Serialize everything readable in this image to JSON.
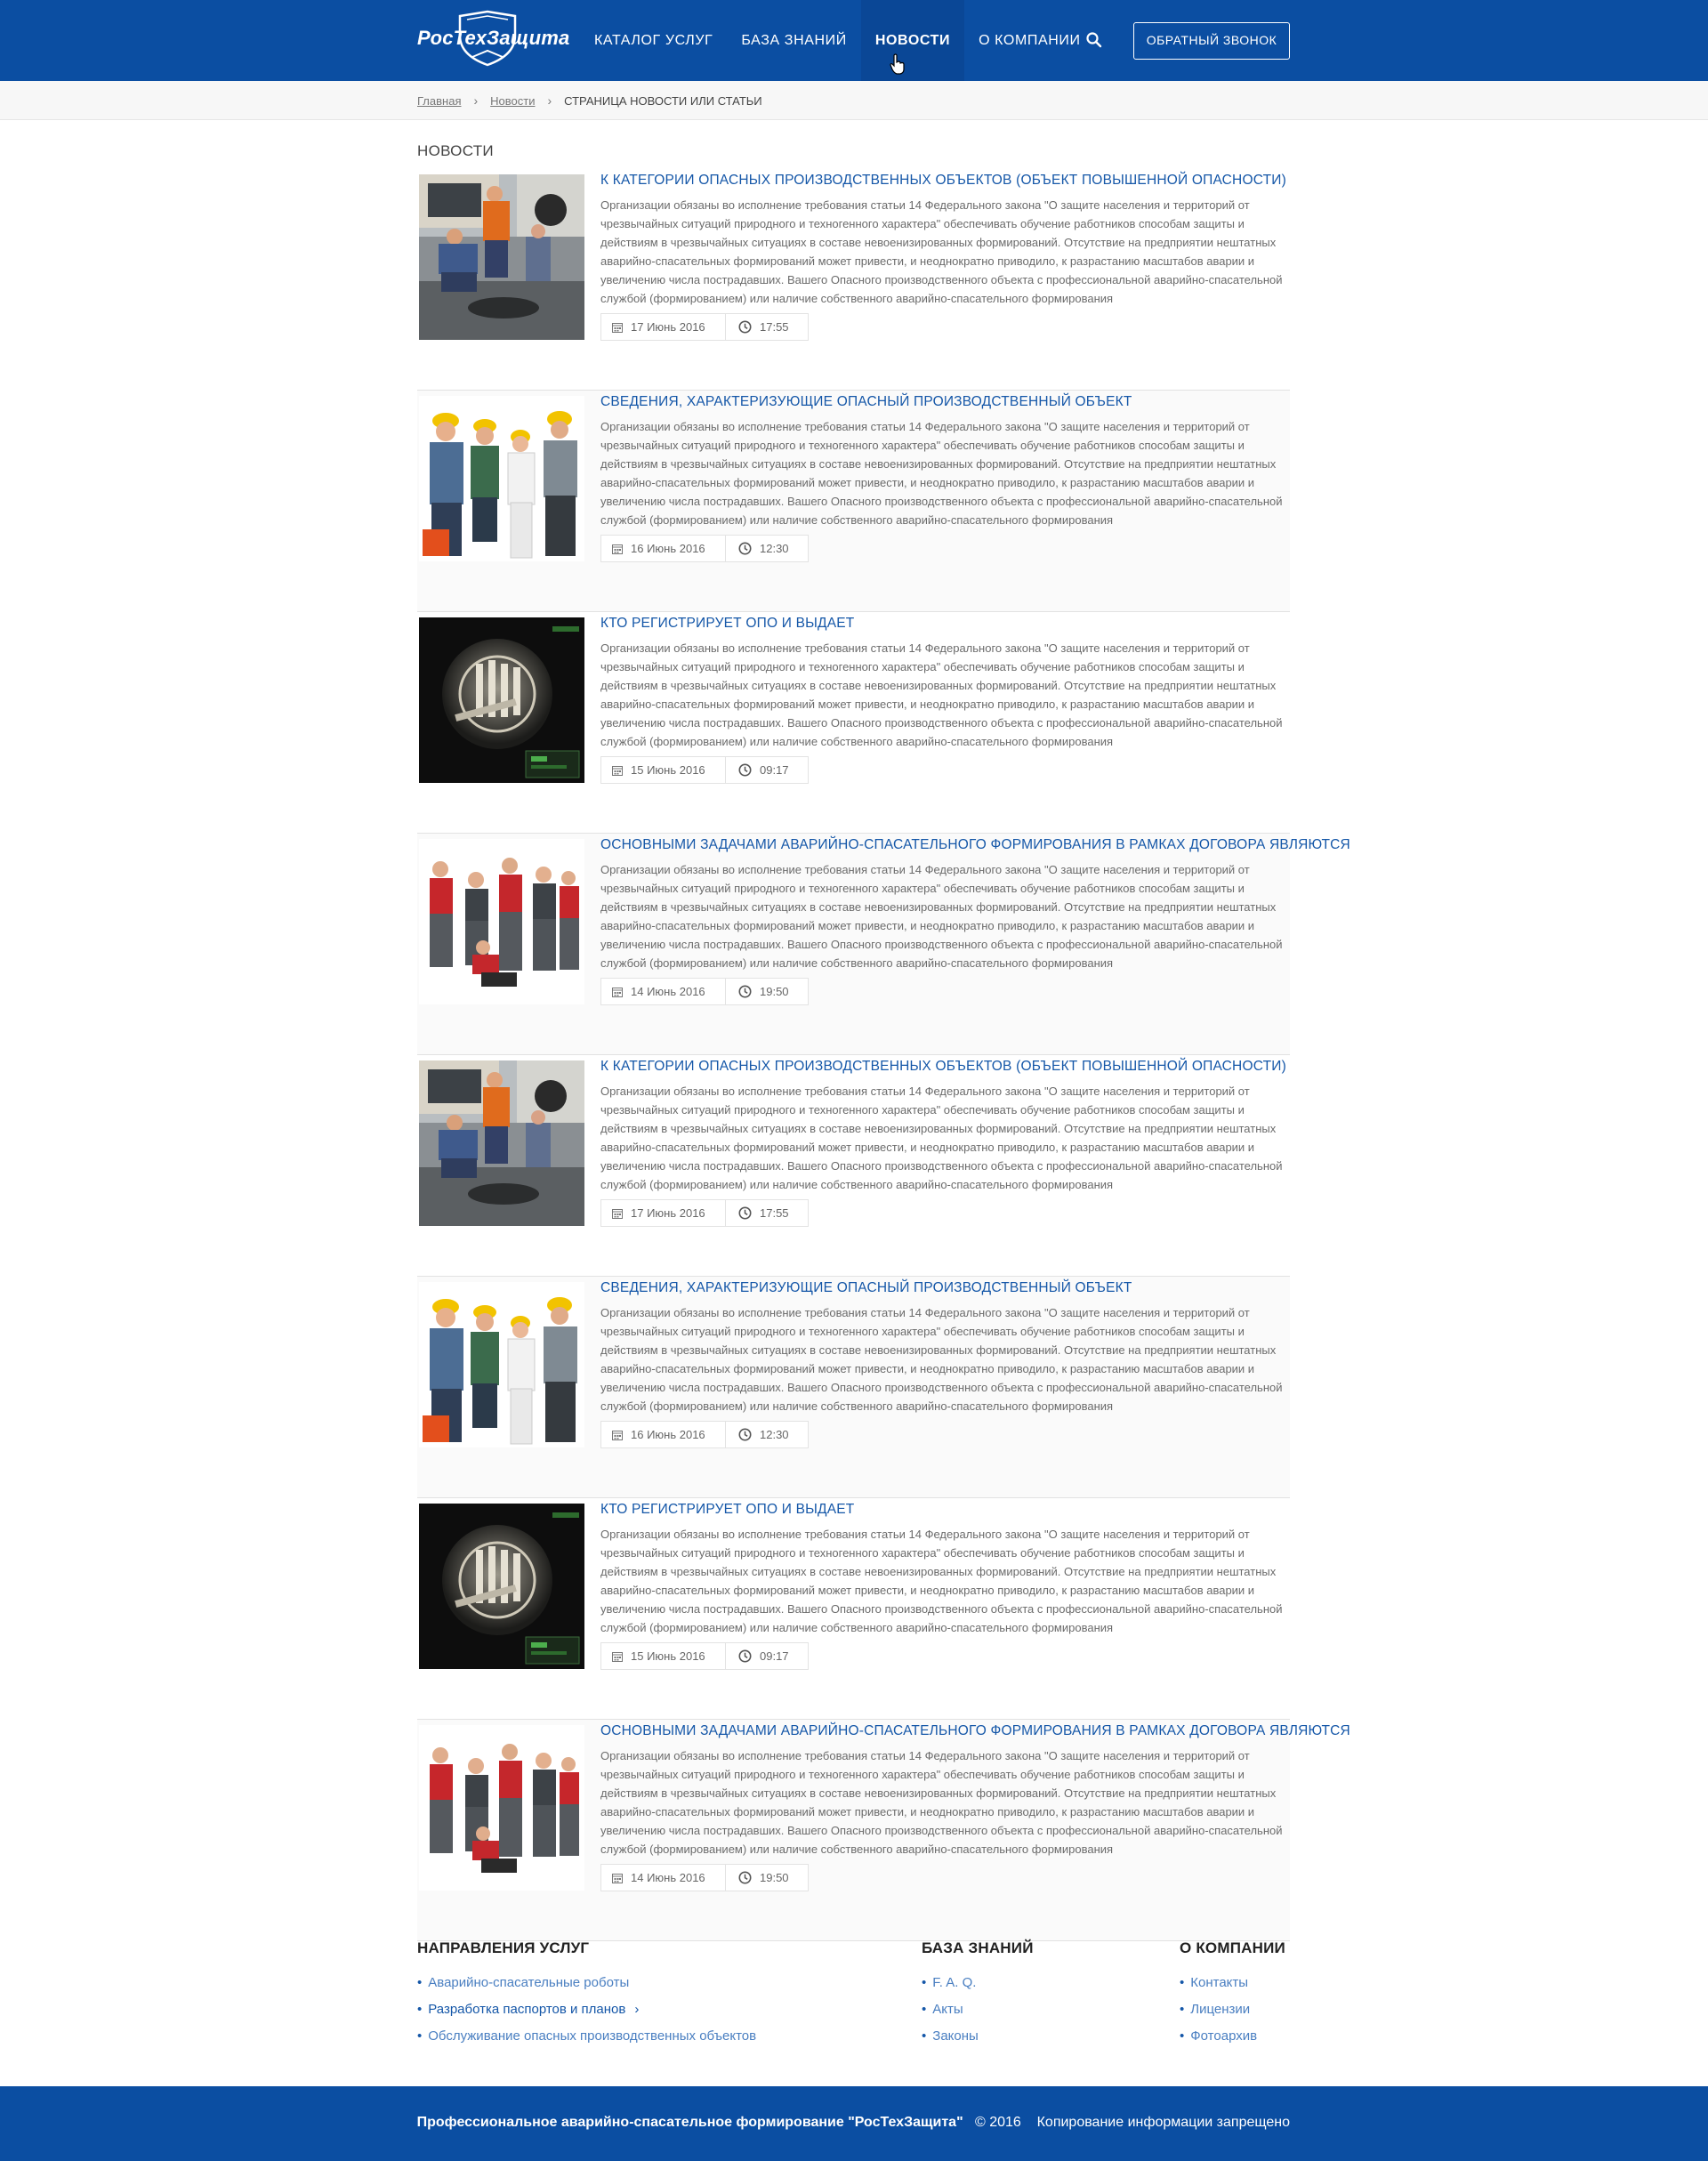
{
  "header": {
    "logo_text": "РосТехЗащита",
    "nav": [
      "Каталог услуг",
      "База знаний",
      "Новости",
      "О компании"
    ],
    "active_nav": "Новости",
    "callback_label": "Обратный звонок"
  },
  "breadcrumb": {
    "home": "Главная",
    "news": "Новости",
    "current": "Страница новости или статьи"
  },
  "page_title": "Новости",
  "articles": [
    {
      "title": "К категории опасных производственных объектов (объект повышенной опасности)",
      "text": "Организации обязаны во исполнение требования статьи 14 Федерального закона \"О защите населения и территорий от чрезвычайных ситуаций природного и техногенного характера\" обеспечивать обучение работников способам защиты и действиям в чрезвычайных ситуациях в составе невоенизированных формирований. Отсутствие на предприятии нештатных аварийно-спасательных формирований может привести, и неоднократно приводило, к разрастанию масштабов аварии и увеличению числа пострадавших.  Вашего Опасного производственного объекта с профессиональной аварийно-спасательной службой (формированием) или наличие собственного аварийно-спасательного формирования",
      "date": "17 Июнь 2016",
      "time": "17:55",
      "image": "workers-manhole"
    },
    {
      "title": "Сведения, характеризующие опасный производственный объект",
      "text": "Организации обязаны во исполнение требования статьи 14 Федерального закона \"О защите населения и территорий от чрезвычайных ситуаций природного и техногенного характера\" обеспечивать обучение работников способам защиты и действиям в чрезвычайных ситуациях в составе невоенизированных формирований. Отсутствие на предприятии нештатных аварийно-спасательных формирований может привести, и неоднократно приводило, к разрастанию масштабов аварии и увеличению числа пострадавших.  Вашего Опасного производственного объекта с профессиональной аварийно-спасательной службой (формированием) или наличие собственного аварийно-спасательного формирования",
      "date": "16 Июнь 2016",
      "time": "12:30",
      "image": "workers-helmets"
    },
    {
      "title": "Кто регистрирует ОПО и выдает",
      "text": "Организации обязаны во исполнение требования статьи 14 Федерального закона \"О защите населения и территорий от чрезвычайных ситуаций природного и техногенного характера\" обеспечивать обучение работников способам защиты и действиям в чрезвычайных ситуациях в составе невоенизированных формирований. Отсутствие на предприятии нештатных аварийно-спасательных формирований может привести, и неоднократно приводило, к разрастанию масштабов аварии и увеличению числа пострадавших.  Вашего Опасного производственного объекта с профессиональной аварийно-спасательной службой (формированием) или наличие собственного аварийно-спасательного формирования",
      "date": "15 Июнь 2016",
      "time": "09:17",
      "image": "vault-door"
    },
    {
      "title": "Основными задачами аварийно-спасательного формирования в рамках договора являются",
      "text": "Организации обязаны во исполнение требования статьи 14 Федерального закона \"О защите населения и территорий от чрезвычайных ситуаций природного и техногенного характера\" обеспечивать обучение работников способам защиты и действиям в чрезвычайных ситуациях в составе невоенизированных формирований. Отсутствие на предприятии нештатных аварийно-спасательных формирований может привести, и неоднократно приводило, к разрастанию масштабов аварии и увеличению числа пострадавших.  Вашего Опасного производственного объекта с профессиональной аварийно-спасательной службой (формированием) или наличие собственного аварийно-спасательного формирования",
      "date": "14 Июнь 2016",
      "time": "19:50",
      "image": "workers-team"
    },
    {
      "title": "К категории опасных производственных объектов (объект повышенной опасности)",
      "text": "Организации обязаны во исполнение требования статьи 14 Федерального закона \"О защите населения и территорий от чрезвычайных ситуаций природного и техногенного характера\" обеспечивать обучение работников способам защиты и действиям в чрезвычайных ситуациях в составе невоенизированных формирований. Отсутствие на предприятии нештатных аварийно-спасательных формирований может привести, и неоднократно приводило, к разрастанию масштабов аварии и увеличению числа пострадавших.  Вашего Опасного производственного объекта с профессиональной аварийно-спасательной службой (формированием) или наличие собственного аварийно-спасательного формирования",
      "date": "17 Июнь 2016",
      "time": "17:55",
      "image": "workers-manhole"
    },
    {
      "title": "Сведения, характеризующие опасный производственный объект",
      "text": "Организации обязаны во исполнение требования статьи 14 Федерального закона \"О защите населения и территорий от чрезвычайных ситуаций природного и техногенного характера\" обеспечивать обучение работников способам защиты и действиям в чрезвычайных ситуациях в составе невоенизированных формирований. Отсутствие на предприятии нештатных аварийно-спасательных формирований может привести, и неоднократно приводило, к разрастанию масштабов аварии и увеличению числа пострадавших.  Вашего Опасного производственного объекта с профессиональной аварийно-спасательной службой (формированием) или наличие собственного аварийно-спасательного формирования",
      "date": "16 Июнь 2016",
      "time": "12:30",
      "image": "workers-helmets"
    },
    {
      "title": "Кто регистрирует ОПО и выдает",
      "text": "Организации обязаны во исполнение требования статьи 14 Федерального закона \"О защите населения и территорий от чрезвычайных ситуаций природного и техногенного характера\" обеспечивать обучение работников способам защиты и действиям в чрезвычайных ситуациях в составе невоенизированных формирований. Отсутствие на предприятии нештатных аварийно-спасательных формирований может привести, и неоднократно приводило, к разрастанию масштабов аварии и увеличению числа пострадавших.  Вашего Опасного производственного объекта с профессиональной аварийно-спасательной службой (формированием) или наличие собственного аварийно-спасательного формирования",
      "date": "15 Июнь 2016",
      "time": "09:17",
      "image": "vault-door"
    },
    {
      "title": "Основными задачами аварийно-спасательного формирования в рамках договора являются",
      "text": "Организации обязаны во исполнение требования статьи 14 Федерального закона \"О защите населения и территорий от чрезвычайных ситуаций природного и техногенного характера\" обеспечивать обучение работников способам защиты и действиям в чрезвычайных ситуациях в составе невоенизированных формирований. Отсутствие на предприятии нештатных аварийно-спасательных формирований может привести, и неоднократно приводило, к разрастанию масштабов аварии и увеличению числа пострадавших.  Вашего Опасного производственного объекта с профессиональной аварийно-спасательной службой (формированием) или наличие собственного аварийно-спасательного формирования",
      "date": "14 Июнь 2016",
      "time": "19:50",
      "image": "workers-team"
    }
  ],
  "footer": {
    "services_title": "Направления услуг",
    "services": [
      "Аварийно-спасательные роботы",
      "Разработка паспортов и планов",
      "Обслуживание опасных производственных объектов"
    ],
    "knowledge_title": "База знаний",
    "knowledge": [
      "F. A. Q.",
      "Акты",
      "Законы"
    ],
    "company_title": "О компании",
    "company": [
      "Контакты",
      "Лицензии",
      "Фотоархив"
    ],
    "copyright_name": "Профессиональное аварийно-спасательное формирование \"РосТехЗащита\"",
    "copyright_year": "© 2016",
    "copyright_note": "Копирование информации запрещено"
  },
  "colors": {
    "brand_blue": "#0b4ea2",
    "link_blue": "#1557a8"
  }
}
